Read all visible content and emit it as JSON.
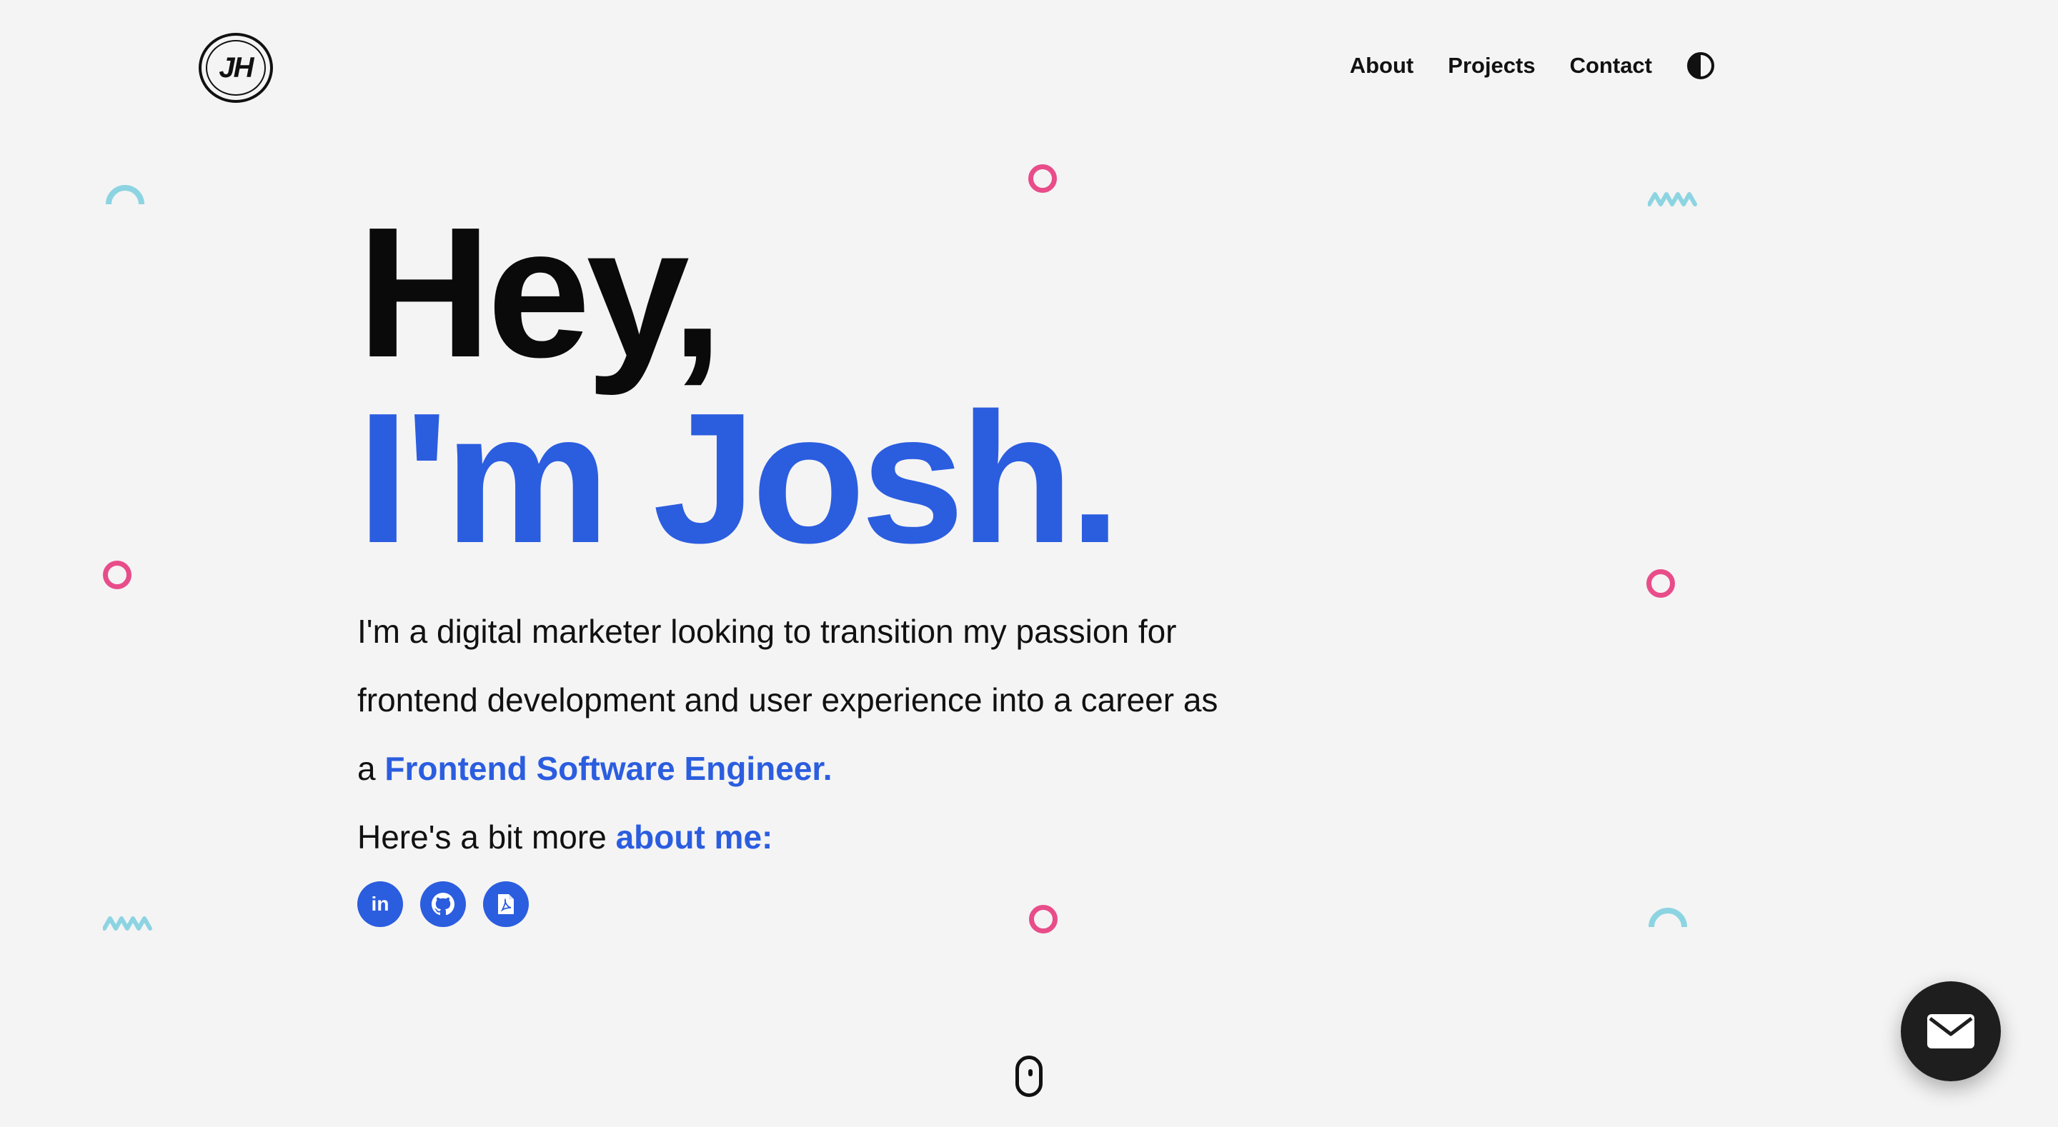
{
  "header": {
    "logo_text": "JH",
    "nav": [
      {
        "label": "About"
      },
      {
        "label": "Projects"
      },
      {
        "label": "Contact"
      }
    ],
    "theme_toggle_icon": "contrast-icon"
  },
  "hero": {
    "greeting": "Hey,",
    "name_line": "I'm Josh.",
    "intro_text": "I'm a digital marketer looking to transition my passion for frontend development and user experience into a career as a ",
    "intro_highlight": "Frontend Software Engineer.",
    "more_text": "Here's a bit more ",
    "more_highlight": "about me:"
  },
  "socials": [
    {
      "icon": "linkedin-icon",
      "glyph": "in"
    },
    {
      "icon": "github-icon"
    },
    {
      "icon": "pdf-resume-icon"
    }
  ],
  "colors": {
    "background": "#f4f4f4",
    "accent_blue": "#2b5ddf",
    "decor_pink": "#e84d8a",
    "decor_cyan": "#8dd4e2",
    "fab": "#1e1e1e"
  },
  "scroll_indicator_icon": "mouse-scroll-icon",
  "fab_icon": "mail-icon"
}
